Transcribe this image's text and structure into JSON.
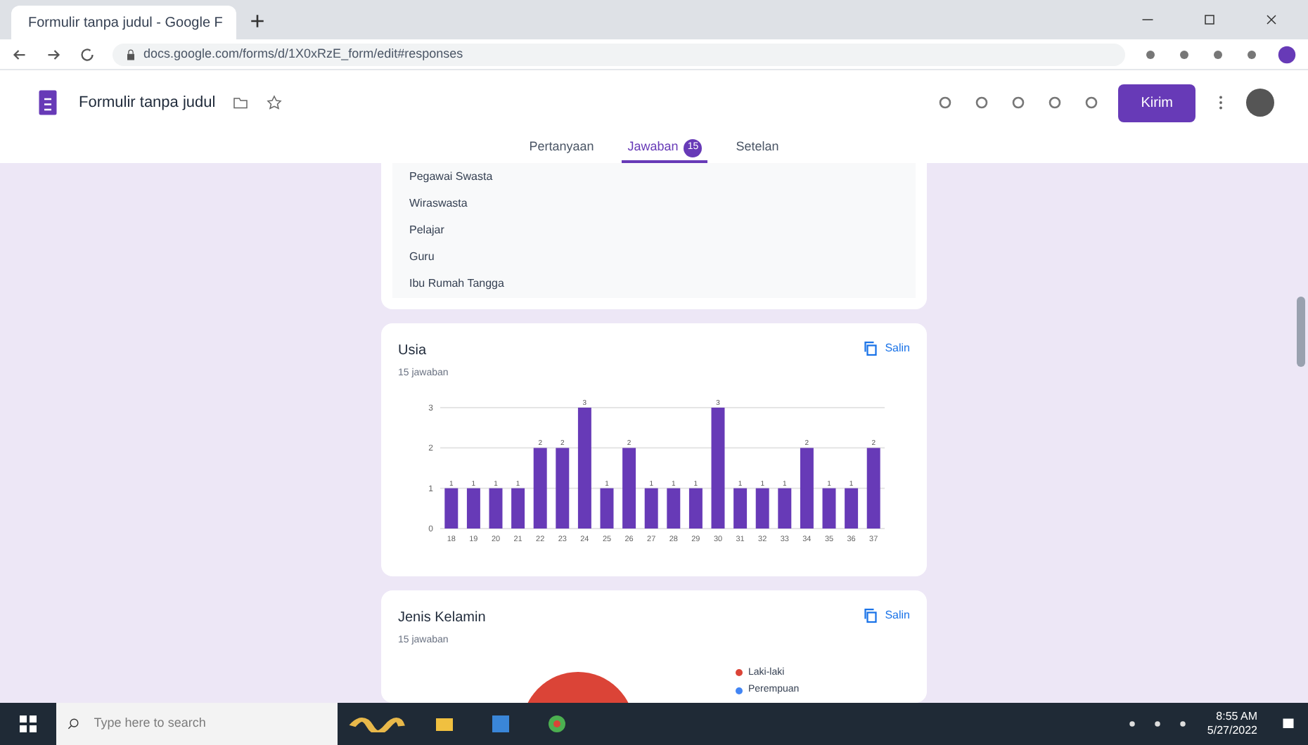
{
  "browser": {
    "tab_title": "Formulir tanpa judul - Google F",
    "url": "docs.google.com/forms/d/1X0xRzE_form/edit#responses"
  },
  "header": {
    "title": "Formulir tanpa judul",
    "send_button": "Kirim"
  },
  "tabs": [
    {
      "label": "Pertanyaan",
      "selected": false
    },
    {
      "label": "Jawaban",
      "selected": true,
      "badge": "15"
    },
    {
      "label": "Setelan",
      "selected": false
    }
  ],
  "answer_list": [
    "Pegawai Swasta",
    "Wiraswasta",
    "Pelajar",
    "Guru",
    "Ibu Rumah Tangga"
  ],
  "cards": [
    {
      "title": "Usia",
      "count": "15 jawaban",
      "copy": "Salin",
      "chart_data": {
        "type": "bar",
        "categories": [
          "18",
          "19",
          "20",
          "21",
          "22",
          "23",
          "24",
          "25",
          "26",
          "27",
          "28",
          "29",
          "30",
          "31",
          "32",
          "33",
          "34",
          "35",
          "36",
          "37"
        ],
        "values": [
          1,
          1,
          1,
          1,
          2,
          2,
          3,
          1,
          2,
          1,
          1,
          1,
          3,
          1,
          1,
          1,
          2,
          1,
          1,
          2
        ],
        "ylim": [
          0,
          3
        ],
        "yticks": [
          0,
          1,
          2,
          3
        ],
        "data_labels": true
      }
    },
    {
      "title": "Jenis Kelamin",
      "count": "15 jawaban",
      "copy": "Salin",
      "legend": [
        {
          "label": "Laki-laki",
          "color": "#db4437"
        },
        {
          "label": "Perempuan",
          "color": "#4285f4"
        }
      ]
    }
  ],
  "taskbar": {
    "search_placeholder": "Type here to search",
    "time": "8:55 AM",
    "date": "5/27/2022"
  }
}
